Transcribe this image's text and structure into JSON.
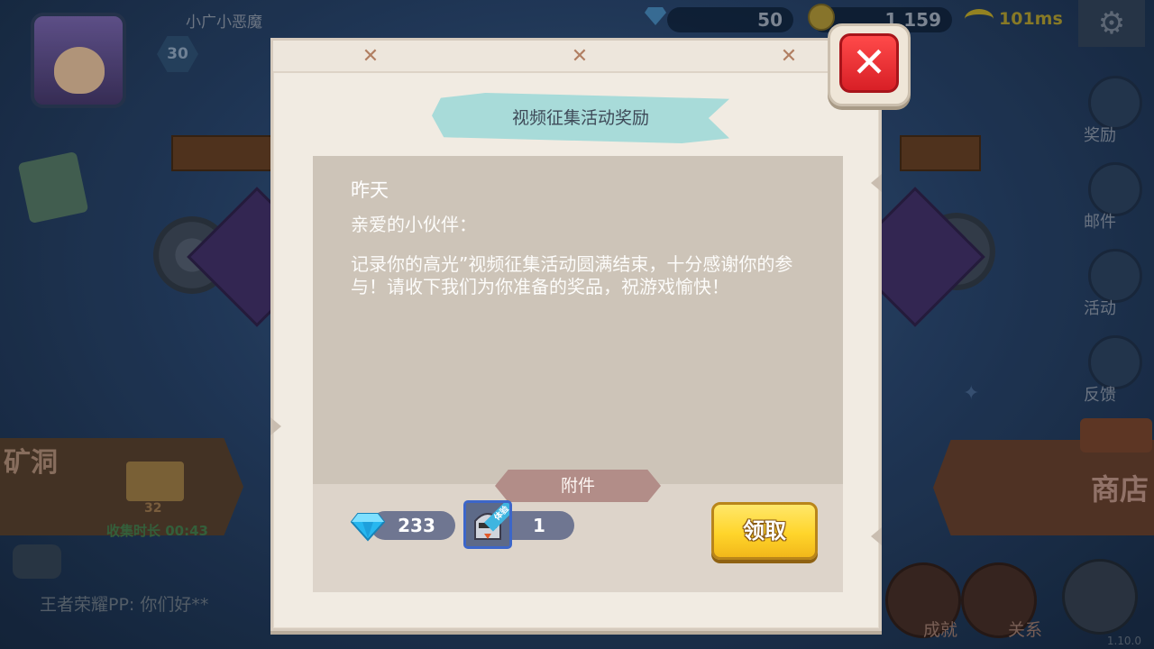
{
  "topbar": {
    "player_name": "小广小恶魔",
    "level": "30",
    "gems": "50",
    "gold": "1 159",
    "ping": "101ms"
  },
  "side_menu": {
    "items": [
      {
        "label": "奖励",
        "icon": "money-bag-icon"
      },
      {
        "label": "邮件",
        "icon": "mail-icon"
      },
      {
        "label": "活动",
        "icon": "flag-icon"
      },
      {
        "label": "反馈",
        "icon": "headset-icon"
      }
    ]
  },
  "background": {
    "shop_label": "商店",
    "mine_label": "矿洞",
    "mine_count": "32",
    "mine_timer": "收集时长 00:43",
    "chat_message": "王者荣耀PP: 你们好**",
    "bottom_nav": [
      "成就",
      "关系"
    ],
    "version": "1.10.0"
  },
  "dialog": {
    "title": "视频征集活动奖励",
    "date": "昨天",
    "greeting": "亲爱的小伙伴：",
    "body": "记录你的高光”视频征集活动圆满结束，十分感谢你的参与！请收下我们为你准备的奖品，祝游戏愉快！",
    "attachment_label": "附件",
    "attachments": [
      {
        "icon": "diamond-icon",
        "count": "233"
      },
      {
        "icon": "character-card-icon",
        "tag": "体验",
        "count": "1"
      }
    ],
    "claim_label": "领取"
  },
  "colors": {
    "accent_yellow": "#ffd52b",
    "close_red": "#d81f26",
    "ribbon": "#a8dbd9",
    "paper": "#f1ebe2"
  }
}
